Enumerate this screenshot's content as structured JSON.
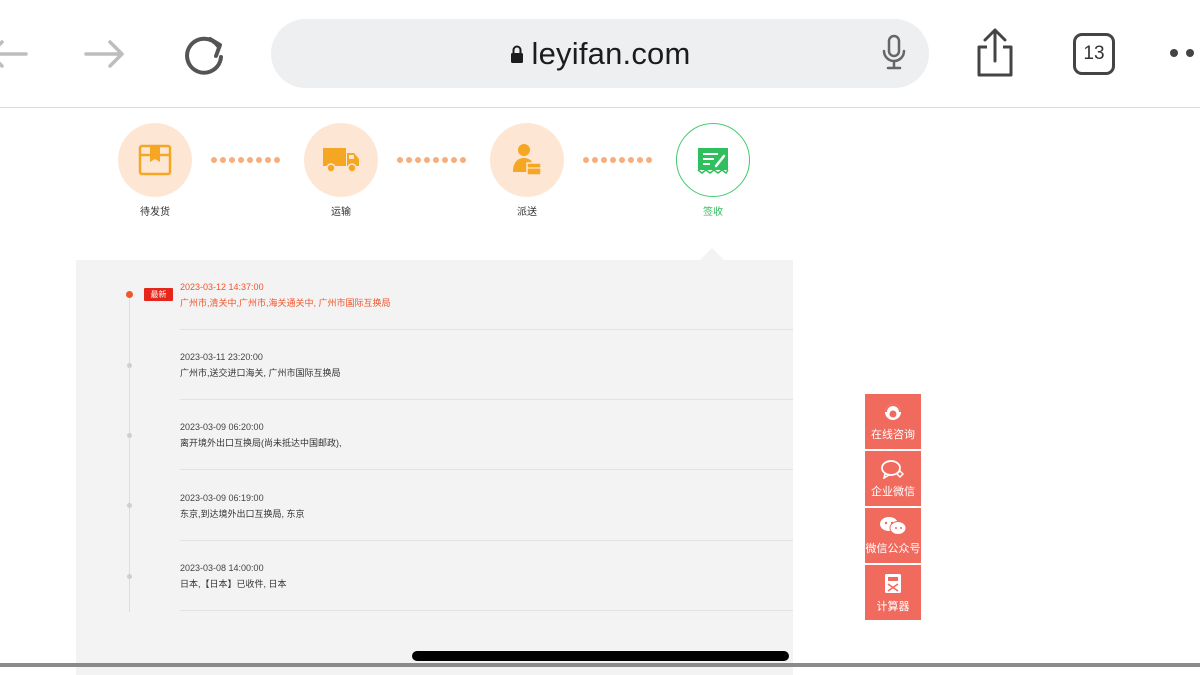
{
  "browser": {
    "url": "leyifan.com",
    "tab_count": "13",
    "icons": {
      "back": "arrow-left-icon",
      "forward": "arrow-right-icon",
      "reload": "reload-icon",
      "lock": "lock-icon",
      "mic": "microphone-icon",
      "share": "share-icon",
      "more": "more-dots-icon"
    }
  },
  "progress": {
    "steps": [
      {
        "label": "待发货",
        "icon": "package-icon",
        "active": false
      },
      {
        "label": "运输",
        "icon": "truck-icon",
        "active": false
      },
      {
        "label": "派送",
        "icon": "courier-icon",
        "active": false
      },
      {
        "label": "签收",
        "icon": "receipt-icon",
        "active": true
      }
    ],
    "colors": {
      "step_bg": "#fde7d4",
      "step_icon": "#f5a623",
      "dots": "#f6ae7d",
      "active": "#2fbf5c"
    }
  },
  "tracking": {
    "latest_badge": "最新",
    "events": [
      {
        "time": "2023-03-12 14:37:00",
        "desc": "广州市,清关中,广州市,海关通关中, 广州市国际互换局",
        "latest": true
      },
      {
        "time": "2023-03-11 23:20:00",
        "desc": "广州市,送交进口海关, 广州市国际互换局",
        "latest": false
      },
      {
        "time": "2023-03-09 06:20:00",
        "desc": "离开境外出口互换局(尚未抵达中国邮政),",
        "latest": false
      },
      {
        "time": "2023-03-09 06:19:00",
        "desc": "东京,到达境外出口互换局, 东京",
        "latest": false
      },
      {
        "time": "2023-03-08 14:00:00",
        "desc": "日本,【日本】已收件, 日本",
        "latest": false
      }
    ],
    "colors": {
      "latest": "#f2552c",
      "badge": "#e6261a"
    }
  },
  "side_buttons": [
    {
      "label": "在线咨询",
      "icon": "support-agent-icon"
    },
    {
      "label": "企业微信",
      "icon": "chat-bubble-icon"
    },
    {
      "label": "微信公众号",
      "icon": "wechat-icon"
    },
    {
      "label": "计算器",
      "icon": "calculator-icon"
    }
  ],
  "side_color": "#f06a5e"
}
